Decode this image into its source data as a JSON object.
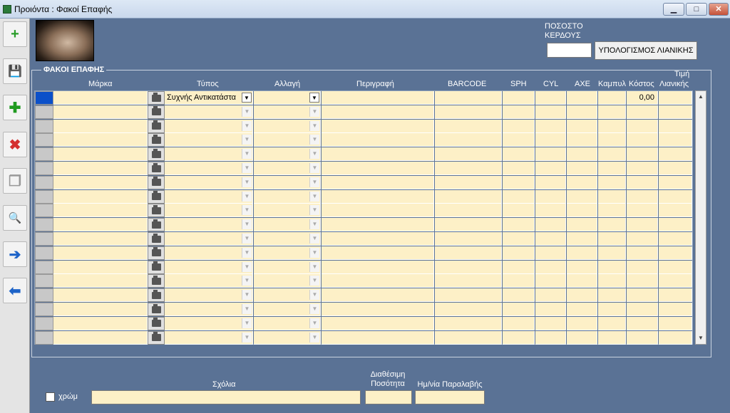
{
  "window": {
    "title": "Προιόντα : Φακοί Επαφής",
    "min_label": "▁",
    "max_label": "□",
    "close_label": "✕"
  },
  "toolbar": {
    "items": [
      {
        "name": "new-book-icon",
        "glyph": "+"
      },
      {
        "name": "save-icon",
        "glyph": "💾"
      },
      {
        "name": "add-icon",
        "glyph": "✚"
      },
      {
        "name": "delete-icon",
        "glyph": "✖"
      },
      {
        "name": "copy-icon",
        "glyph": "❐"
      },
      {
        "name": "search-icon",
        "glyph": "🔍"
      },
      {
        "name": "next-arrow-icon",
        "glyph": "➔"
      },
      {
        "name": "prev-arrow-icon",
        "glyph": "⬅"
      }
    ]
  },
  "profit": {
    "label_line1": "ΠΟΣΟΣΤΟ",
    "label_line2": "ΚΕΡΔΟΥΣ",
    "value": "",
    "calc_button": "ΥΠΟΛΟΓΙΣΜΟΣ ΛΙΑΝΙΚΗΣ"
  },
  "group": {
    "title": "ΦΑΚΟΙ ΕΠΑΦΗΣ"
  },
  "grid": {
    "headers": {
      "brand": "Μάρκα",
      "type": "Τύπος",
      "change": "Αλλαγή",
      "description": "Περιγραφή",
      "barcode": "BARCODE",
      "sph": "SPH",
      "cyl": "CYL",
      "axe": "AXE",
      "curve": "Καμπυλ",
      "cost": "Κόστος",
      "retail_line1": "Τιμή",
      "retail_line2": "Λιανικής"
    },
    "first_row": {
      "type": "Συχνής Αντικατάστα",
      "cost": "0,00"
    },
    "row_count": 18
  },
  "bottom": {
    "color_label": "χρώμ",
    "notes_label": "Σχόλια",
    "available_line1": "Διαθέσιμη",
    "available_line2": "Ποσότητα",
    "received_label": "Ημ/νία Παραλαβής",
    "notes_value": "",
    "available_value": "",
    "received_value": ""
  }
}
